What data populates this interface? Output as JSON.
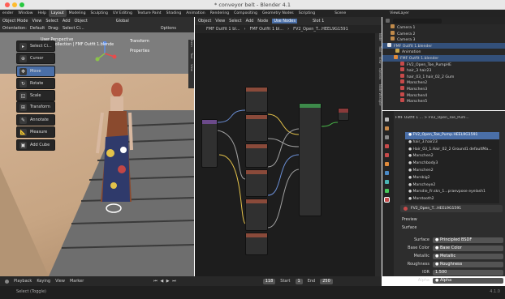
{
  "window": {
    "title": "* conveyor belt - Blender 4.1"
  },
  "topbar": {
    "menus": [
      "ender",
      "Window",
      "Help"
    ],
    "tabs": [
      "Layout",
      "Modeling",
      "Sculpting",
      "UV Editing",
      "Texture Paint",
      "Shading",
      "Animation",
      "Rendering",
      "Compositing",
      "Geometry Nodes",
      "Scripting"
    ],
    "active_tab": "Layout",
    "scene_label": "Scene",
    "viewlayer_label": "ViewLayer"
  },
  "viewport": {
    "mode": "Object Mode",
    "menus": [
      "View",
      "Select",
      "Add",
      "Object"
    ],
    "orientation_label": "Orientation:",
    "orientation_value": "Default",
    "drag_label": "Drag:",
    "drag_value": "Select Ci...",
    "global": "Global",
    "options": "Options",
    "info_line1": "User Perspective",
    "info_line2": "(118) Collection | FMF Outfit 1.blende",
    "transform": "Transform",
    "properties": "Properties",
    "side_tabs": [
      "Item",
      "Tool",
      "View"
    ],
    "tools": [
      "Select Ci...",
      "Cursor",
      "Move",
      "Rotate",
      "Scale",
      "Transform",
      "Annotate",
      "Measure",
      "Add Cube"
    ],
    "active_tool": "Move"
  },
  "node_editor": {
    "editor_label": "Object",
    "menus": [
      "View",
      "Select",
      "Add",
      "Node"
    ],
    "use_nodes": "Use Nodes",
    "slot": "Slot 1",
    "breadcrumb": [
      "FMF Outfit 1 bl...",
      "FMF Outfit 1 bl...",
      "FV2_Open_T...HEEL9G1591"
    ],
    "side_tabs": [
      "Node",
      "Tool",
      "View",
      "Options",
      "Node Wrangler"
    ]
  },
  "outliner": {
    "items": [
      {
        "label": "Camera 1",
        "type": "camera"
      },
      {
        "label": "Camera 2",
        "type": "camera"
      },
      {
        "label": "Camera 3",
        "type": "camera"
      },
      {
        "label": "FMF Outfit 1.blender",
        "type": "collection",
        "selected": true
      },
      {
        "label": "Animation",
        "type": "anim"
      },
      {
        "label": "FMF Outfit 1.blender",
        "type": "object",
        "selected": true
      },
      {
        "label": "FV2_Open_Toe_PumpHE",
        "type": "mesh"
      },
      {
        "label": "hair_3 hair23",
        "type": "mesh"
      },
      {
        "label": "hair_03_1 hair_02_2 Gum",
        "type": "mesh"
      },
      {
        "label": "Marschen2",
        "type": "mesh"
      },
      {
        "label": "Marschen3",
        "type": "mesh"
      },
      {
        "label": "Marschen4",
        "type": "mesh"
      },
      {
        "label": "Marschen5",
        "type": "mesh"
      }
    ]
  },
  "properties": {
    "breadcrumb": "FMF Outfit 1 ... > FV2_Open_Toe_Pum...",
    "materials": [
      "FV2_Open_Toe_Pump.HEEL9G1591",
      "hair_3.hair23",
      "Hair_03_1.Hair_02_2 Ground1 defaultMa...",
      "Marschen2",
      "Marschbody3",
      "Marschen2",
      "Marsbig2",
      "Marscheye2",
      "Marsdie_Fr.skn_1...praevpose eyelash1",
      "Marstooth2"
    ],
    "selected_material": 0,
    "material_name": "FV2_Open_T...HEEL9G1591",
    "preview": "Preview",
    "surface": "Surface",
    "fields": [
      {
        "label": "Surface",
        "value": "Principled BSDF",
        "dot": "#48b448"
      },
      {
        "label": "Base Color",
        "value": "Base Color",
        "dot": "#e5c34a"
      },
      {
        "label": "Metallic",
        "value": "Metallic",
        "dot": "#a0a0a0"
      },
      {
        "label": "Roughness",
        "value": "Roughness",
        "dot": "#a0a0a0"
      },
      {
        "label": "IOR",
        "value": "1.500",
        "dot": ""
      },
      {
        "label": "Alpha",
        "value": "Alpha",
        "dot": "#a0a0a0"
      }
    ]
  },
  "timeline": {
    "playback": "Playback",
    "keying": "Keying",
    "view": "View",
    "marker": "Marker",
    "frame": "118",
    "start_label": "Start",
    "start": "1",
    "end_label": "End",
    "end": "250"
  },
  "status": {
    "left": "Select (Toggle)",
    "version": "4.1.0"
  }
}
